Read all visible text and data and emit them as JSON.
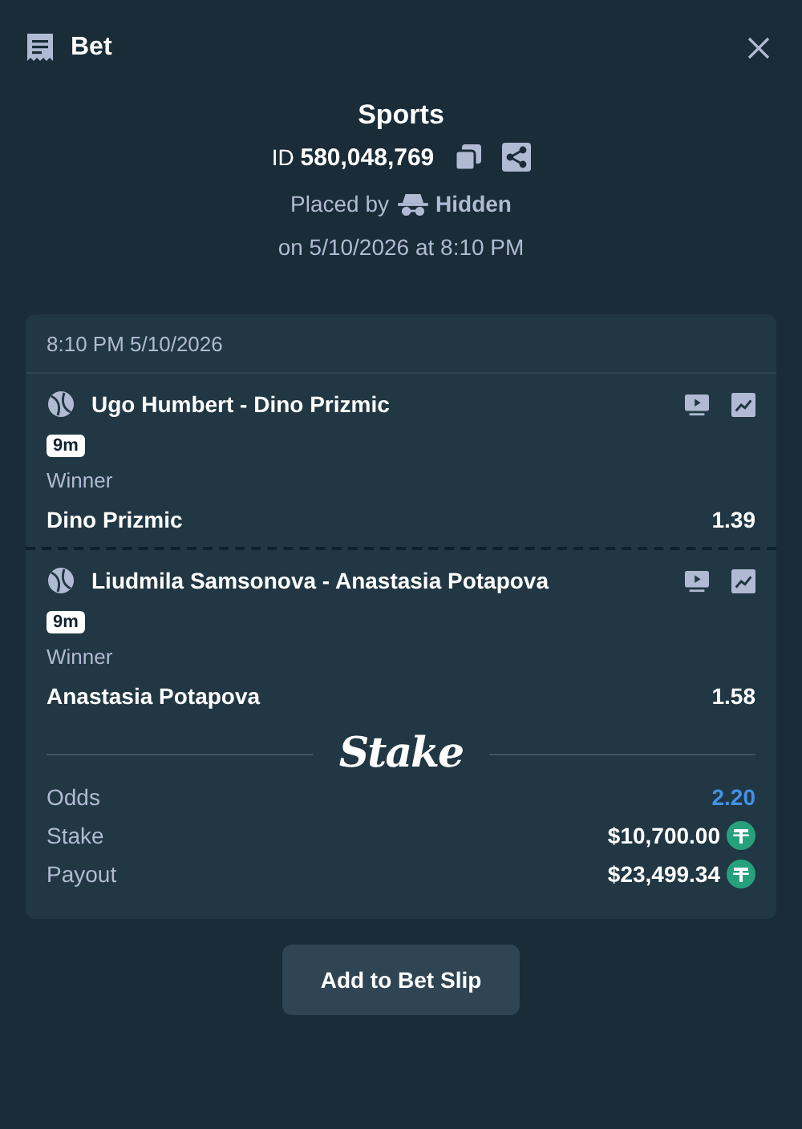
{
  "header": {
    "title": "Bet"
  },
  "info": {
    "category": "Sports",
    "id_label": "ID",
    "id": "580,048,769",
    "placed_by_label": "Placed by",
    "placed_by": "Hidden",
    "placed_on": "on 5/10/2026 at 8:10 PM"
  },
  "card": {
    "date": "8:10 PM 5/10/2026",
    "legs": [
      {
        "match": "Ugo Humbert - Dino Prizmic",
        "badge": "9m",
        "market": "Winner",
        "selection": "Dino Prizmic",
        "odds": "1.39"
      },
      {
        "match": "Liudmila Samsonova - Anastasia Potapova",
        "badge": "9m",
        "market": "Winner",
        "selection": "Anastasia Potapova",
        "odds": "1.58"
      }
    ],
    "brand": "Stake",
    "summary": [
      {
        "label": "Odds",
        "value": "2.20",
        "kind": "odds"
      },
      {
        "label": "Stake",
        "value": "$10,700.00",
        "kind": "currency"
      },
      {
        "label": "Payout",
        "value": "$23,499.34",
        "kind": "currency"
      }
    ]
  },
  "button": "Add to Bet Slip"
}
